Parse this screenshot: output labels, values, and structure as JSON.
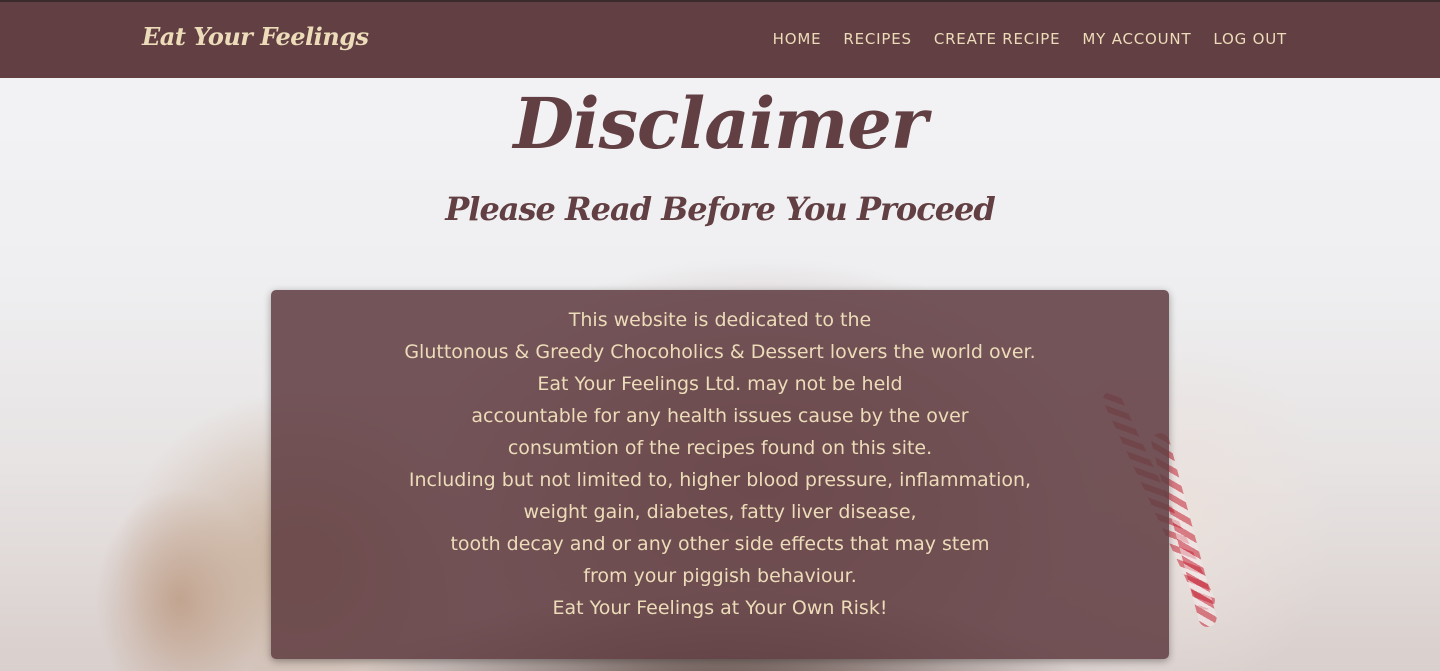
{
  "navbar": {
    "brand": "Eat Your Feelings",
    "links": [
      "HOME",
      "RECIPES",
      "CREATE RECIPE",
      "MY ACCOUNT",
      "LOG OUT"
    ]
  },
  "page": {
    "title": "Disclaimer",
    "subtitle": "Please Read Before You Proceed"
  },
  "disclaimer": {
    "lines": [
      "This website is dedicated to the",
      "Gluttonous & Greedy Chocoholics & Dessert lovers the world over.",
      "Eat Your Feelings Ltd. may not be held",
      "accountable for any health issues cause by the over",
      "consumtion of the recipes found on this site.",
      "Including but not limited to, higher blood pressure, inflammation,",
      "weight gain, diabetes, fatty liver disease,",
      "tooth decay and or any other side effects that may stem",
      "from your piggish behaviour.",
      "Eat Your Feelings at Your Own Risk!"
    ]
  },
  "colors": {
    "nav_bg": "#623f43",
    "accent_text": "#ecdcb9",
    "heading": "#623f43"
  }
}
